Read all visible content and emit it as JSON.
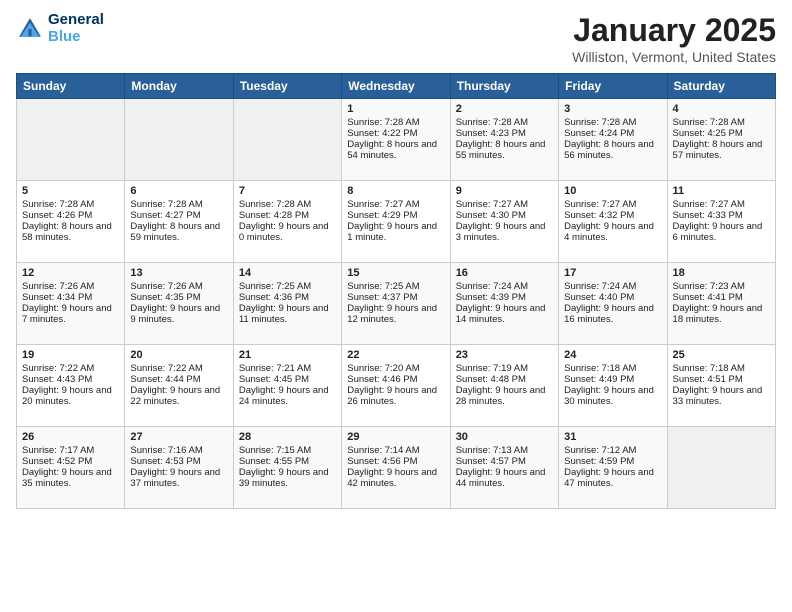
{
  "header": {
    "logo_line1": "General",
    "logo_line2": "Blue",
    "title": "January 2025",
    "subtitle": "Williston, Vermont, United States"
  },
  "days_of_week": [
    "Sunday",
    "Monday",
    "Tuesday",
    "Wednesday",
    "Thursday",
    "Friday",
    "Saturday"
  ],
  "weeks": [
    [
      {
        "day": "",
        "empty": true
      },
      {
        "day": "",
        "empty": true
      },
      {
        "day": "",
        "empty": true
      },
      {
        "day": "1",
        "sunrise": "7:28 AM",
        "sunset": "4:22 PM",
        "daylight": "8 hours and 54 minutes."
      },
      {
        "day": "2",
        "sunrise": "7:28 AM",
        "sunset": "4:23 PM",
        "daylight": "8 hours and 55 minutes."
      },
      {
        "day": "3",
        "sunrise": "7:28 AM",
        "sunset": "4:24 PM",
        "daylight": "8 hours and 56 minutes."
      },
      {
        "day": "4",
        "sunrise": "7:28 AM",
        "sunset": "4:25 PM",
        "daylight": "8 hours and 57 minutes."
      }
    ],
    [
      {
        "day": "5",
        "sunrise": "7:28 AM",
        "sunset": "4:26 PM",
        "daylight": "8 hours and 58 minutes."
      },
      {
        "day": "6",
        "sunrise": "7:28 AM",
        "sunset": "4:27 PM",
        "daylight": "8 hours and 59 minutes."
      },
      {
        "day": "7",
        "sunrise": "7:28 AM",
        "sunset": "4:28 PM",
        "daylight": "9 hours and 0 minutes."
      },
      {
        "day": "8",
        "sunrise": "7:27 AM",
        "sunset": "4:29 PM",
        "daylight": "9 hours and 1 minute."
      },
      {
        "day": "9",
        "sunrise": "7:27 AM",
        "sunset": "4:30 PM",
        "daylight": "9 hours and 3 minutes."
      },
      {
        "day": "10",
        "sunrise": "7:27 AM",
        "sunset": "4:32 PM",
        "daylight": "9 hours and 4 minutes."
      },
      {
        "day": "11",
        "sunrise": "7:27 AM",
        "sunset": "4:33 PM",
        "daylight": "9 hours and 6 minutes."
      }
    ],
    [
      {
        "day": "12",
        "sunrise": "7:26 AM",
        "sunset": "4:34 PM",
        "daylight": "9 hours and 7 minutes."
      },
      {
        "day": "13",
        "sunrise": "7:26 AM",
        "sunset": "4:35 PM",
        "daylight": "9 hours and 9 minutes."
      },
      {
        "day": "14",
        "sunrise": "7:25 AM",
        "sunset": "4:36 PM",
        "daylight": "9 hours and 11 minutes."
      },
      {
        "day": "15",
        "sunrise": "7:25 AM",
        "sunset": "4:37 PM",
        "daylight": "9 hours and 12 minutes."
      },
      {
        "day": "16",
        "sunrise": "7:24 AM",
        "sunset": "4:39 PM",
        "daylight": "9 hours and 14 minutes."
      },
      {
        "day": "17",
        "sunrise": "7:24 AM",
        "sunset": "4:40 PM",
        "daylight": "9 hours and 16 minutes."
      },
      {
        "day": "18",
        "sunrise": "7:23 AM",
        "sunset": "4:41 PM",
        "daylight": "9 hours and 18 minutes."
      }
    ],
    [
      {
        "day": "19",
        "sunrise": "7:22 AM",
        "sunset": "4:43 PM",
        "daylight": "9 hours and 20 minutes."
      },
      {
        "day": "20",
        "sunrise": "7:22 AM",
        "sunset": "4:44 PM",
        "daylight": "9 hours and 22 minutes."
      },
      {
        "day": "21",
        "sunrise": "7:21 AM",
        "sunset": "4:45 PM",
        "daylight": "9 hours and 24 minutes."
      },
      {
        "day": "22",
        "sunrise": "7:20 AM",
        "sunset": "4:46 PM",
        "daylight": "9 hours and 26 minutes."
      },
      {
        "day": "23",
        "sunrise": "7:19 AM",
        "sunset": "4:48 PM",
        "daylight": "9 hours and 28 minutes."
      },
      {
        "day": "24",
        "sunrise": "7:18 AM",
        "sunset": "4:49 PM",
        "daylight": "9 hours and 30 minutes."
      },
      {
        "day": "25",
        "sunrise": "7:18 AM",
        "sunset": "4:51 PM",
        "daylight": "9 hours and 33 minutes."
      }
    ],
    [
      {
        "day": "26",
        "sunrise": "7:17 AM",
        "sunset": "4:52 PM",
        "daylight": "9 hours and 35 minutes."
      },
      {
        "day": "27",
        "sunrise": "7:16 AM",
        "sunset": "4:53 PM",
        "daylight": "9 hours and 37 minutes."
      },
      {
        "day": "28",
        "sunrise": "7:15 AM",
        "sunset": "4:55 PM",
        "daylight": "9 hours and 39 minutes."
      },
      {
        "day": "29",
        "sunrise": "7:14 AM",
        "sunset": "4:56 PM",
        "daylight": "9 hours and 42 minutes."
      },
      {
        "day": "30",
        "sunrise": "7:13 AM",
        "sunset": "4:57 PM",
        "daylight": "9 hours and 44 minutes."
      },
      {
        "day": "31",
        "sunrise": "7:12 AM",
        "sunset": "4:59 PM",
        "daylight": "9 hours and 47 minutes."
      },
      {
        "day": "",
        "empty": true
      }
    ]
  ],
  "labels": {
    "sunrise_prefix": "Sunrise: ",
    "sunset_prefix": "Sunset: ",
    "daylight_prefix": "Daylight: "
  }
}
